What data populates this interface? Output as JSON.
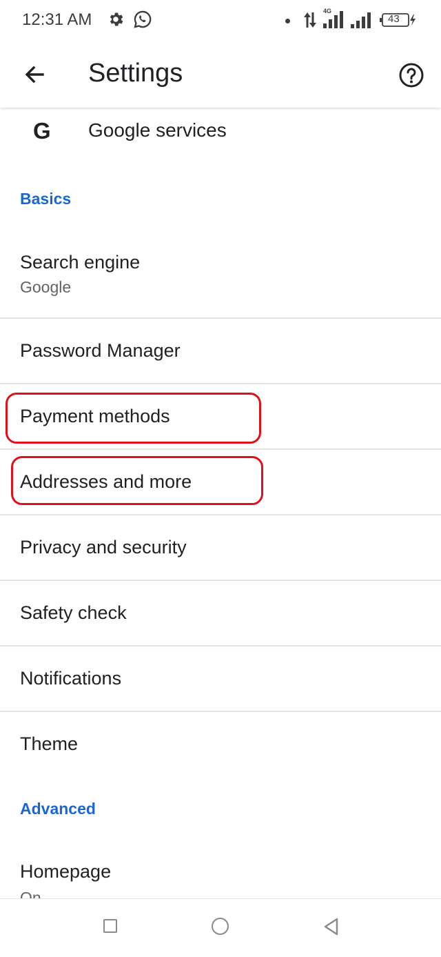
{
  "status_bar": {
    "time": "12:31 AM",
    "network_type": "4G",
    "battery_level": "43",
    "icons": [
      "gear-icon",
      "whatsapp-icon",
      "data-arrows-icon",
      "signal-icon",
      "battery-icon"
    ]
  },
  "app_bar": {
    "title": "Settings",
    "back_icon": "arrow-left-icon",
    "help_icon": "help-icon"
  },
  "account": {
    "google_icon_text": "G",
    "google_services_label": "Google services"
  },
  "sections": {
    "basics": "Basics",
    "advanced": "Advanced"
  },
  "items": [
    {
      "title": "Search engine",
      "subtitle": "Google"
    },
    {
      "title": "Password Manager"
    },
    {
      "title": "Payment methods",
      "highlighted": true
    },
    {
      "title": "Addresses and more",
      "highlighted": true
    },
    {
      "title": "Privacy and security"
    },
    {
      "title": "Safety check"
    },
    {
      "title": "Notifications"
    },
    {
      "title": "Theme"
    },
    {
      "title": "Homepage",
      "subtitle": "On"
    }
  ],
  "colors": {
    "section_header": "#1a67d2",
    "highlight_outline": "#e0101a",
    "divider": "#e3e3e3"
  },
  "nav_bar": {
    "icons": [
      "recents-square-icon",
      "home-circle-icon",
      "back-triangle-icon"
    ]
  }
}
